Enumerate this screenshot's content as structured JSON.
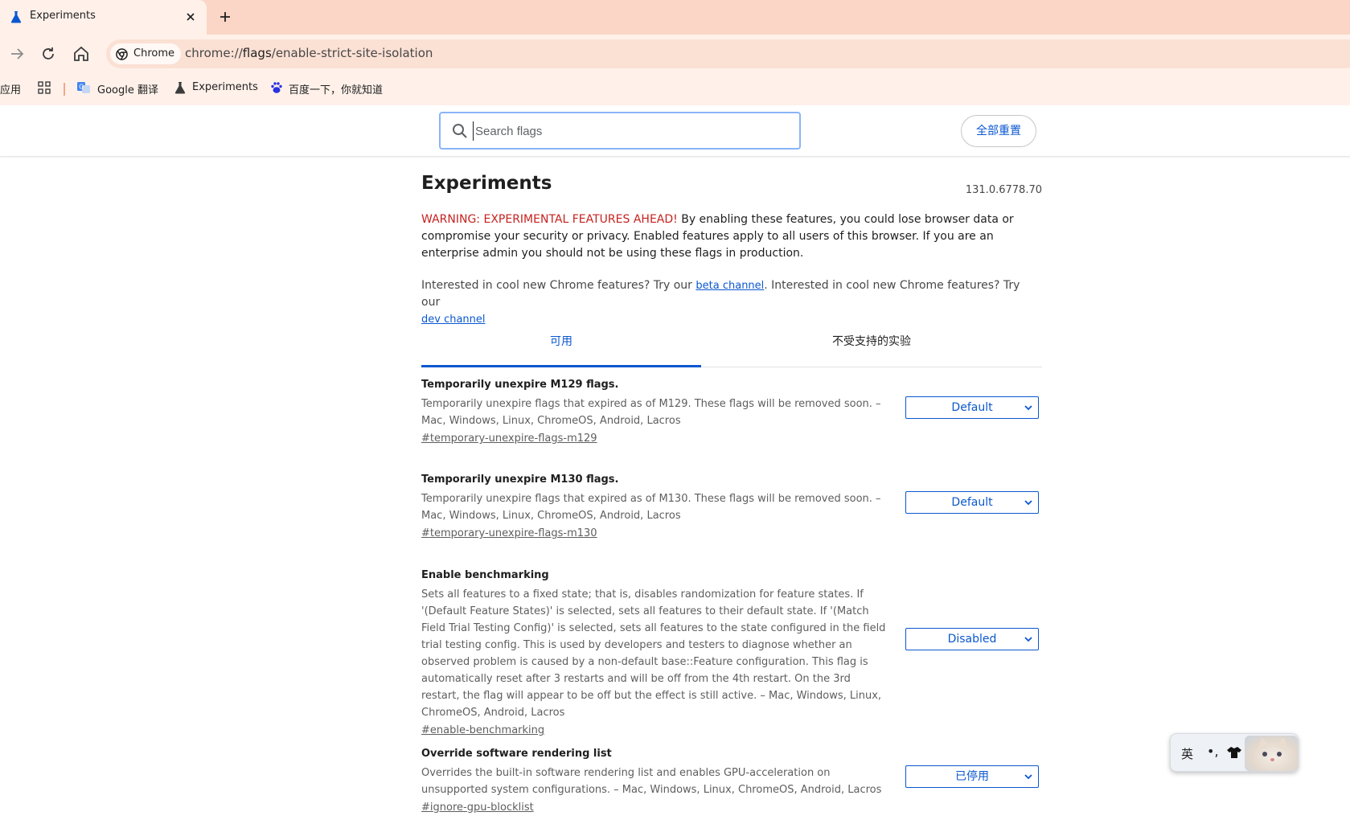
{
  "browser": {
    "tab_title": "Experiments",
    "chip_label": "Chrome",
    "url_scheme": "chrome://",
    "url_host": "flags",
    "url_path": "/enable-strict-site-isolation"
  },
  "bookmarks": {
    "apps_label": "应用",
    "items": [
      {
        "label": "Google 翻译",
        "icon": "google-translate-icon"
      },
      {
        "label": "Experiments",
        "icon": "flask-icon"
      },
      {
        "label": "百度一下，你就知道",
        "icon": "baidu-paw-icon"
      }
    ]
  },
  "header": {
    "search_placeholder": "Search flags",
    "reset_label": "全部重置"
  },
  "page": {
    "title": "Experiments",
    "version": "131.0.6778.70",
    "warning_red": "WARNING: EXPERIMENTAL FEATURES AHEAD!",
    "warning_text": " By enabling these features, you could lose browser data or compromise your security or privacy. Enabled features apply to all users of this browser. If you are an enterprise admin you should not be using these flags in production.",
    "promo_1": "Interested in cool new Chrome features? Try our ",
    "beta_link": "beta channel",
    "promo_2": ". Interested in cool new Chrome features? Try our ",
    "dev_link": "dev channel"
  },
  "tabs": {
    "available": "可用",
    "unavailable": "不受支持的实验"
  },
  "flags": [
    {
      "name": "Temporarily unexpire M129 flags.",
      "description": "Temporarily unexpire flags that expired as of M129. These flags will be removed soon. – Mac, Windows, Linux, ChromeOS, Android, Lacros",
      "link": "#temporary-unexpire-flags-m129",
      "value": "Default"
    },
    {
      "name": "Temporarily unexpire M130 flags.",
      "description": "Temporarily unexpire flags that expired as of M130. These flags will be removed soon. – Mac, Windows, Linux, ChromeOS, Android, Lacros",
      "link": "#temporary-unexpire-flags-m130",
      "value": "Default"
    },
    {
      "name": "Enable benchmarking",
      "description": "Sets all features to a fixed state; that is, disables randomization for feature states. If '(Default Feature States)' is selected, sets all features to their default state. If '(Match Field Trial Testing Config)' is selected, sets all features to the state configured in the field trial testing config. This is used by developers and testers to diagnose whether an observed problem is caused by a non-default base::Feature configuration. This flag is automatically reset after 3 restarts and will be off from the 4th restart. On the 3rd restart, the flag will appear to be off but the effect is still active. – Mac, Windows, Linux, ChromeOS, Android, Lacros",
      "link": "#enable-benchmarking",
      "value": "Disabled"
    },
    {
      "name": "Override software rendering list",
      "description": "Overrides the built-in software rendering list and enables GPU-acceleration on unsupported system configurations. – Mac, Windows, Linux, ChromeOS, Android, Lacros",
      "link": "#ignore-gpu-blocklist",
      "value": "已停用"
    }
  ],
  "ime": {
    "lang": "英",
    "punct": "•,"
  },
  "colors": {
    "accent": "#0b57d0",
    "warning": "#c5221f",
    "tabstrip": "#fbd6c6",
    "toolbar": "#fff1ea"
  }
}
